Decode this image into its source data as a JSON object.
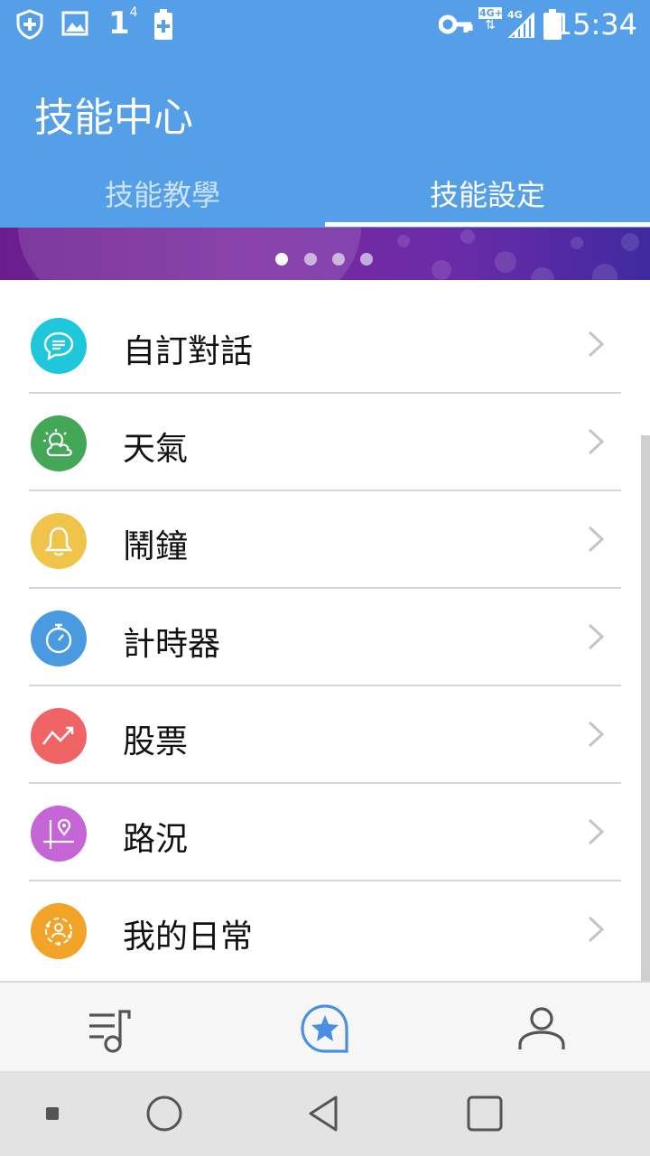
{
  "status_bar": {
    "time": "15:34",
    "signal_label_1": "1",
    "signal_label_2": "4",
    "network_badge_1": "4G+",
    "network_badge_2": "4G",
    "icons": [
      "shield-plus-icon",
      "image-icon",
      "signal-number-icon",
      "battery-plus-icon",
      "key-icon",
      "network-4g-plus-icon",
      "network-4g-signal-icon",
      "battery-icon"
    ]
  },
  "app_bar": {
    "title": "技能中心",
    "tabs": [
      {
        "label": "技能教學",
        "selected": false
      },
      {
        "label": "技能設定",
        "selected": true
      }
    ]
  },
  "banner": {
    "page_count": 4,
    "active_page": 1
  },
  "skills": [
    {
      "label": "自訂對話",
      "icon": "chat-bubble-icon",
      "color": "#1ec7d9"
    },
    {
      "label": "天氣",
      "icon": "weather-icon",
      "color": "#43a757"
    },
    {
      "label": "鬧鐘",
      "icon": "bell-icon",
      "color": "#f0c34a"
    },
    {
      "label": "計時器",
      "icon": "stopwatch-icon",
      "color": "#4a9ae2"
    },
    {
      "label": "股票",
      "icon": "stock-trend-icon",
      "color": "#f06466"
    },
    {
      "label": "路況",
      "icon": "map-pin-icon",
      "color": "#c565d6"
    },
    {
      "label": "我的日常",
      "icon": "routine-icon",
      "color": "#f2a428"
    }
  ],
  "bottom_nav": {
    "items": [
      {
        "icon": "music-list-icon",
        "active": false
      },
      {
        "icon": "star-chat-icon",
        "active": true
      },
      {
        "icon": "person-icon",
        "active": false
      }
    ],
    "active_color": "#4a90e2"
  },
  "system_nav": {
    "icons": [
      "recents-square-icon",
      "home-circle-icon",
      "back-triangle-icon",
      "overview-square-icon"
    ]
  },
  "colors": {
    "primary": "#559fe9",
    "banner": "#6b1d8f"
  }
}
